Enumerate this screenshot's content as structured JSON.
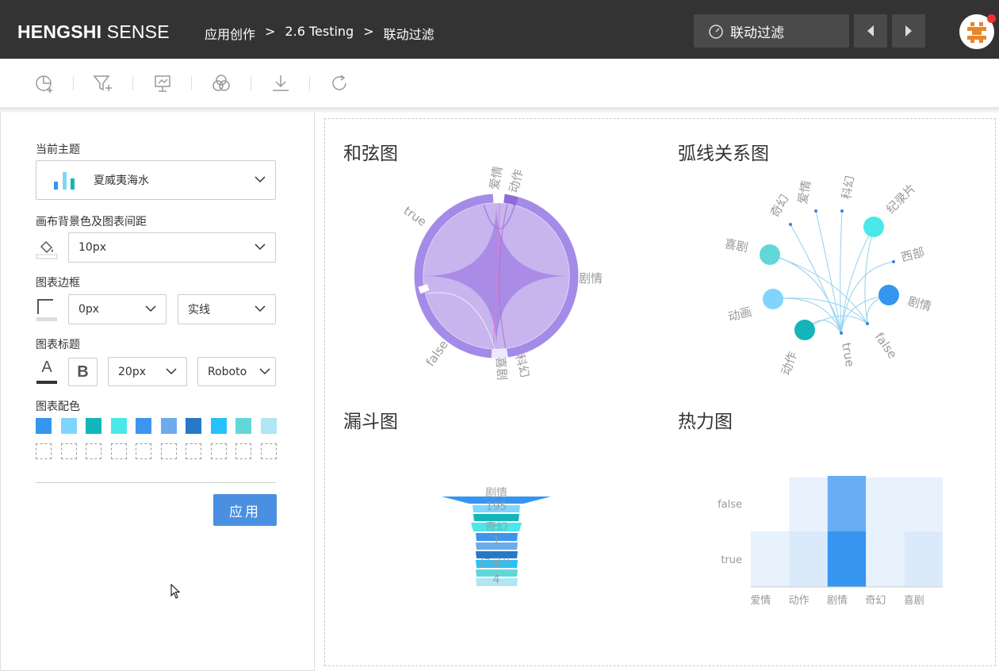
{
  "app": {
    "logo_bold": "HENGSHI",
    "logo_rest": " SENSE"
  },
  "breadcrumb": [
    "应用创作",
    ">",
    "2.6 Testing",
    ">",
    "联动过滤"
  ],
  "header": {
    "mode_label": "联动过滤",
    "prev_icon": "chevron-left-icon",
    "next_icon": "chevron-right-icon"
  },
  "toolbar": {
    "tools": [
      "add-chart-icon",
      "add-filter-icon",
      "presentation-icon",
      "color-theme-icon",
      "download-icon",
      "refresh-icon"
    ]
  },
  "settings": {
    "theme_label": "当前主题",
    "theme_value": "夏威夷海水",
    "bg_label": "画布背景色及图表间距",
    "bg_value": "10px",
    "border_label": "图表边框",
    "border_width": "0px",
    "border_style": "实线",
    "title_label": "图表标题",
    "title_color_glyph": "A",
    "title_bold_glyph": "B",
    "title_size": "20px",
    "title_font": "Roboto",
    "palette_label": "图表配色",
    "palette": [
      "#3595f0",
      "#7fd5fc",
      "#14b5b8",
      "#4ae8e8",
      "#3d95ee",
      "#6cabed",
      "#2479c8",
      "#27c2fb",
      "#62d7d8",
      "#b2e5f4"
    ],
    "apply_label": "应用"
  },
  "charts": {
    "chord": {
      "title": "和弦图",
      "labels": [
        "爱情",
        "动作",
        "剧情",
        "科幻",
        "喜剧",
        "false",
        "true"
      ]
    },
    "arc": {
      "title": "弧线关系图",
      "labels": [
        "爱情",
        "科幻",
        "奇幻",
        "纪录片",
        "西部",
        "喜剧",
        "剧情",
        "动画",
        "false",
        "动作",
        "true"
      ]
    },
    "funnel": {
      "title": "漏斗图",
      "labels": [
        "剧情",
        "195",
        "奇幻",
        "1",
        "纪录片",
        "4"
      ]
    },
    "heatmap": {
      "title": "热力图"
    }
  },
  "chart_data": [
    {
      "type": "heatmap",
      "title": "热力图",
      "x": [
        "爱情",
        "动作",
        "剧情",
        "奇幻",
        "喜剧"
      ],
      "y": [
        "false",
        "true"
      ]
    },
    {
      "type": "bar",
      "title": "漏斗图",
      "categories": [
        "剧情",
        "奇幻",
        "纪录片"
      ],
      "values": [
        195,
        1,
        4
      ]
    }
  ]
}
